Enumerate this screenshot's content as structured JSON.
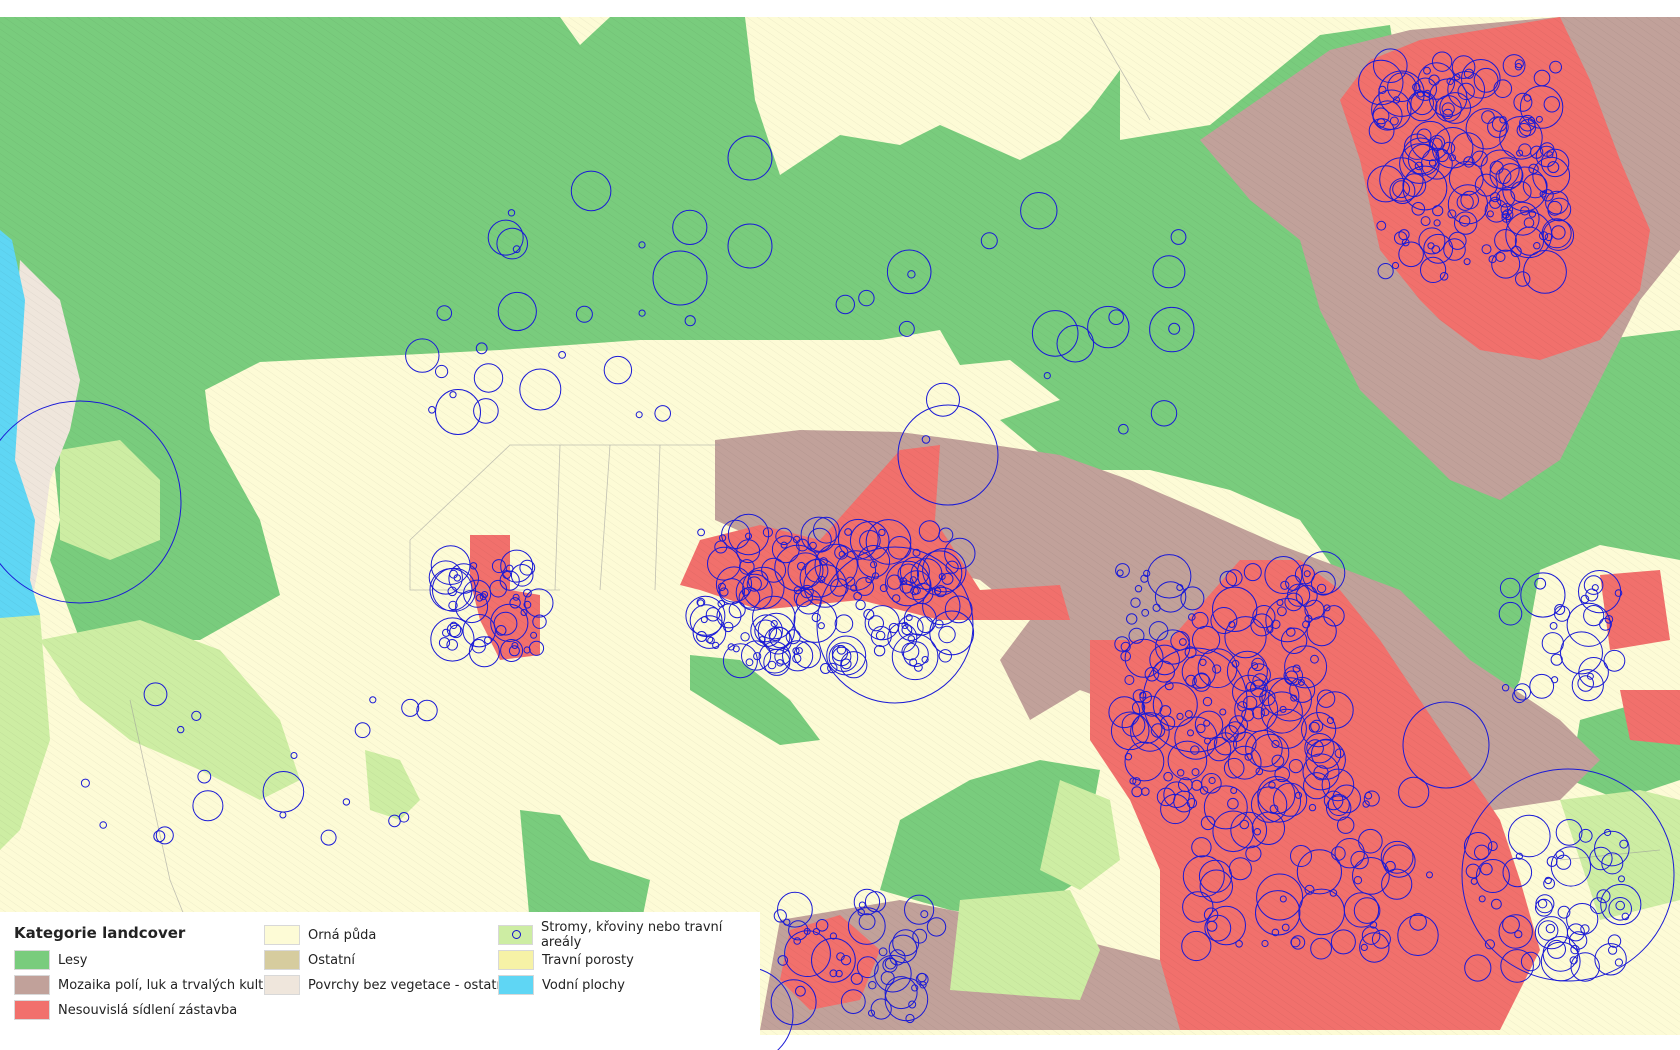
{
  "legend": {
    "title": "Kategorie landcover",
    "items": [
      {
        "id": "lesy",
        "label": "Lesy",
        "color": "#79cc7d"
      },
      {
        "id": "mozaika",
        "label": "Mozaika polí, luk a trvalých kultur",
        "color": "#c1a19a"
      },
      {
        "id": "sidelni",
        "label": "Nesouvislá sídlení zástavba",
        "color": "#f1706c"
      },
      {
        "id": "orna",
        "label": "Orná půda",
        "color": "#fdfbd6"
      },
      {
        "id": "ostatni",
        "label": "Ostatní",
        "color": "#d6cc9e"
      },
      {
        "id": "povrchy",
        "label": "Povrchy bez vegetace - ostatní",
        "color": "#efe6dc"
      },
      {
        "id": "stromy",
        "label": "Stromy, křoviny nebo travní areály",
        "color": "#cdeda3"
      },
      {
        "id": "travni",
        "label": "Travní porosty",
        "color": "#f6f2a6"
      },
      {
        "id": "vodni",
        "label": "Vodní plochy",
        "color": "#5fd6f4"
      }
    ]
  },
  "symbology": {
    "circle_stroke": "#1a1ad6",
    "hatch_color": "#c9c48a",
    "boundary_color": "#9a9a9a"
  }
}
